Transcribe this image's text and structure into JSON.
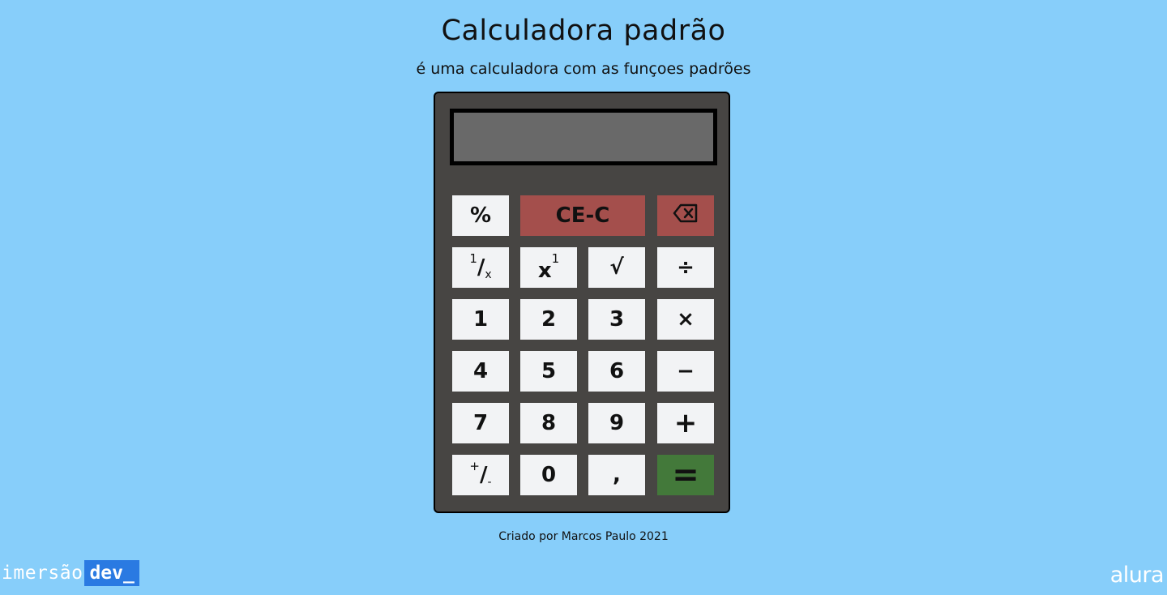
{
  "header": {
    "title": "Calculadora padrão",
    "subtitle": "é uma calculadora com as funçoes padrões"
  },
  "display": {
    "value": ""
  },
  "keys": {
    "percent": "%",
    "clear": "CE-C",
    "backspace_icon": "backspace-icon",
    "reciprocal_num": "1",
    "reciprocal_slash": "/",
    "reciprocal_den": "x",
    "power_base": "x",
    "power_exp": "1",
    "sqrt": "√",
    "divide": "÷",
    "one": "1",
    "two": "2",
    "three": "3",
    "multiply": "×",
    "four": "4",
    "five": "5",
    "six": "6",
    "minus": "−",
    "seven": "7",
    "eight": "8",
    "nine": "9",
    "plus": "+",
    "sign_plus": "+",
    "sign_slash": "/",
    "sign_minus": "-",
    "zero": "0",
    "comma": ",",
    "equals": "="
  },
  "footer": {
    "credit": "Criado por Marcos Paulo 2021"
  },
  "branding": {
    "imersao": "imersão",
    "dev": "dev_",
    "alura": "alura"
  },
  "colors": {
    "background": "#87cefa",
    "calculator_body": "#474543",
    "display": "#696969",
    "key": "#f2f3f5",
    "key_red": "#a44f4c",
    "key_green": "#43793a",
    "dev_badge": "#2a7ae2"
  }
}
